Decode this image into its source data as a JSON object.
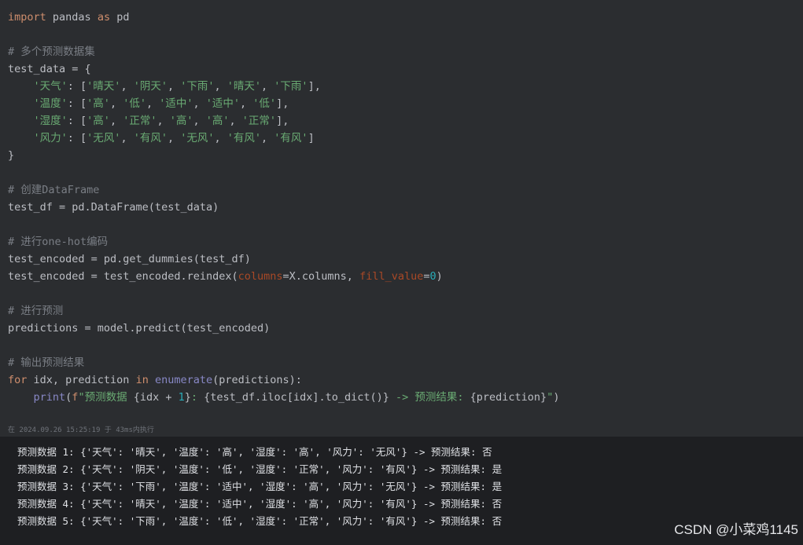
{
  "code": {
    "lines": [
      [
        {
          "t": "kw",
          "v": "import"
        },
        {
          "t": "plain",
          "v": " pandas "
        },
        {
          "t": "kw",
          "v": "as"
        },
        {
          "t": "plain",
          "v": " pd"
        }
      ],
      [],
      [
        {
          "t": "comment",
          "v": "# 多个预测数据集"
        }
      ],
      [
        {
          "t": "plain",
          "v": "test_data = {"
        }
      ],
      [
        {
          "t": "plain",
          "v": "    "
        },
        {
          "t": "str",
          "v": "'天气'"
        },
        {
          "t": "plain",
          "v": ": ["
        },
        {
          "t": "str",
          "v": "'晴天'"
        },
        {
          "t": "plain",
          "v": ", "
        },
        {
          "t": "str",
          "v": "'阴天'"
        },
        {
          "t": "plain",
          "v": ", "
        },
        {
          "t": "str",
          "v": "'下雨'"
        },
        {
          "t": "plain",
          "v": ", "
        },
        {
          "t": "str",
          "v": "'晴天'"
        },
        {
          "t": "plain",
          "v": ", "
        },
        {
          "t": "str",
          "v": "'下雨'"
        },
        {
          "t": "plain",
          "v": "],"
        }
      ],
      [
        {
          "t": "plain",
          "v": "    "
        },
        {
          "t": "str",
          "v": "'温度'"
        },
        {
          "t": "plain",
          "v": ": ["
        },
        {
          "t": "str",
          "v": "'高'"
        },
        {
          "t": "plain",
          "v": ", "
        },
        {
          "t": "str",
          "v": "'低'"
        },
        {
          "t": "plain",
          "v": ", "
        },
        {
          "t": "str",
          "v": "'适中'"
        },
        {
          "t": "plain",
          "v": ", "
        },
        {
          "t": "str",
          "v": "'适中'"
        },
        {
          "t": "plain",
          "v": ", "
        },
        {
          "t": "str",
          "v": "'低'"
        },
        {
          "t": "plain",
          "v": "],"
        }
      ],
      [
        {
          "t": "plain",
          "v": "    "
        },
        {
          "t": "str",
          "v": "'湿度'"
        },
        {
          "t": "plain",
          "v": ": ["
        },
        {
          "t": "str",
          "v": "'高'"
        },
        {
          "t": "plain",
          "v": ", "
        },
        {
          "t": "str",
          "v": "'正常'"
        },
        {
          "t": "plain",
          "v": ", "
        },
        {
          "t": "str",
          "v": "'高'"
        },
        {
          "t": "plain",
          "v": ", "
        },
        {
          "t": "str",
          "v": "'高'"
        },
        {
          "t": "plain",
          "v": ", "
        },
        {
          "t": "str",
          "v": "'正常'"
        },
        {
          "t": "plain",
          "v": "],"
        }
      ],
      [
        {
          "t": "plain",
          "v": "    "
        },
        {
          "t": "str",
          "v": "'风力'"
        },
        {
          "t": "plain",
          "v": ": ["
        },
        {
          "t": "str",
          "v": "'无风'"
        },
        {
          "t": "plain",
          "v": ", "
        },
        {
          "t": "str",
          "v": "'有风'"
        },
        {
          "t": "plain",
          "v": ", "
        },
        {
          "t": "str",
          "v": "'无风'"
        },
        {
          "t": "plain",
          "v": ", "
        },
        {
          "t": "str",
          "v": "'有风'"
        },
        {
          "t": "plain",
          "v": ", "
        },
        {
          "t": "str",
          "v": "'有风'"
        },
        {
          "t": "plain",
          "v": "]"
        }
      ],
      [
        {
          "t": "plain",
          "v": "}"
        }
      ],
      [],
      [
        {
          "t": "comment",
          "v": "# 创建DataFrame"
        }
      ],
      [
        {
          "t": "plain",
          "v": "test_df = pd.DataFrame(test_data)"
        }
      ],
      [],
      [
        {
          "t": "comment",
          "v": "# 进行one-hot编码"
        }
      ],
      [
        {
          "t": "plain",
          "v": "test_encoded = pd.get_dummies(test_df)"
        }
      ],
      [
        {
          "t": "plain",
          "v": "test_encoded = test_encoded.reindex("
        },
        {
          "t": "param",
          "v": "columns"
        },
        {
          "t": "plain",
          "v": "=X.columns, "
        },
        {
          "t": "param",
          "v": "fill_value"
        },
        {
          "t": "plain",
          "v": "="
        },
        {
          "t": "num",
          "v": "0"
        },
        {
          "t": "plain",
          "v": ")"
        }
      ],
      [],
      [
        {
          "t": "comment",
          "v": "# 进行预测"
        }
      ],
      [
        {
          "t": "plain",
          "v": "predictions = model.predict(test_encoded)"
        }
      ],
      [],
      [
        {
          "t": "comment",
          "v": "# 输出预测结果"
        }
      ],
      [
        {
          "t": "kw",
          "v": "for"
        },
        {
          "t": "plain",
          "v": " idx, prediction "
        },
        {
          "t": "kw",
          "v": "in"
        },
        {
          "t": "plain",
          "v": " "
        },
        {
          "t": "builtin",
          "v": "enumerate"
        },
        {
          "t": "plain",
          "v": "(predictions):"
        }
      ],
      [
        {
          "t": "plain",
          "v": "    "
        },
        {
          "t": "builtin",
          "v": "print"
        },
        {
          "t": "plain",
          "v": "("
        },
        {
          "t": "kw",
          "v": "f"
        },
        {
          "t": "str",
          "v": "\"预测数据 "
        },
        {
          "t": "plain",
          "v": "{idx + "
        },
        {
          "t": "num",
          "v": "1"
        },
        {
          "t": "plain",
          "v": "}"
        },
        {
          "t": "str",
          "v": ": "
        },
        {
          "t": "plain",
          "v": "{test_df.iloc[idx].to_dict()}"
        },
        {
          "t": "str",
          "v": " -> 预测结果: "
        },
        {
          "t": "plain",
          "v": "{prediction}"
        },
        {
          "t": "str",
          "v": "\""
        },
        {
          "t": "plain",
          "v": ")"
        }
      ]
    ]
  },
  "execution": {
    "status_text": "在 2024.09.26 15:25:19 于 43ms内执行"
  },
  "output": {
    "lines": [
      "预测数据 1: {'天气': '晴天', '温度': '高', '湿度': '高', '风力': '无风'} -> 预测结果: 否",
      "预测数据 2: {'天气': '阴天', '温度': '低', '湿度': '正常', '风力': '有风'} -> 预测结果: 是",
      "预测数据 3: {'天气': '下雨', '温度': '适中', '湿度': '高', '风力': '无风'} -> 预测结果: 是",
      "预测数据 4: {'天气': '晴天', '温度': '适中', '湿度': '高', '风力': '有风'} -> 预测结果: 否",
      "预测数据 5: {'天气': '下雨', '温度': '低', '湿度': '正常', '风力': '有风'} -> 预测结果: 否"
    ]
  },
  "watermark": {
    "text": "CSDN @小菜鸡1145"
  },
  "colors": {
    "editor_bg": "#2b2d30",
    "output_bg": "#1e1f22",
    "keyword": "#cf8e6d",
    "comment": "#7a7e85",
    "string": "#6aab73",
    "number": "#2aacb8",
    "named_param": "#aa4926",
    "builtin": "#8888c6",
    "plain": "#bcbec4"
  }
}
